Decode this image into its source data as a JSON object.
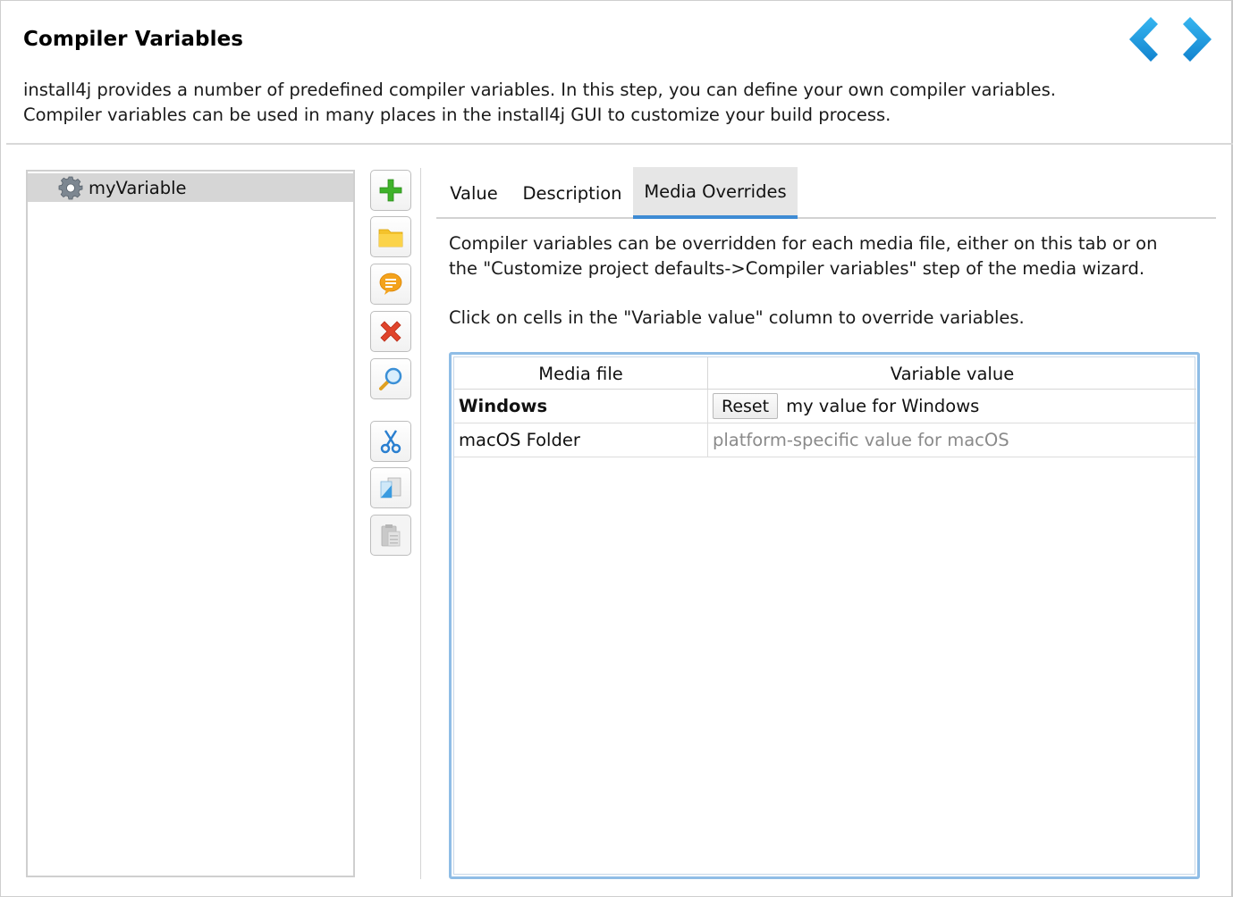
{
  "header": {
    "title": "Compiler Variables",
    "description": "install4j provides a number of predefined compiler variables. In this step, you can define your own compiler variables. Compiler variables can be used in many places in the install4j GUI to customize your build process.",
    "back_icon": "chevron-left-icon",
    "forward_icon": "chevron-right-icon",
    "accent_color": "#1e9be0"
  },
  "tree": {
    "items": [
      {
        "label": "myVariable",
        "icon": "gear-icon"
      }
    ]
  },
  "toolbar": {
    "buttons": [
      {
        "name": "add",
        "icon": "plus-icon"
      },
      {
        "name": "add-folder",
        "icon": "folder-icon"
      },
      {
        "name": "add-comment",
        "icon": "comment-icon"
      },
      {
        "name": "delete",
        "icon": "delete-x-icon"
      },
      {
        "name": "search",
        "icon": "magnifier-icon"
      },
      {
        "name": "cut",
        "icon": "scissors-icon"
      },
      {
        "name": "copy",
        "icon": "copy-icon"
      },
      {
        "name": "paste",
        "icon": "paste-icon",
        "disabled": true
      }
    ]
  },
  "tabs": [
    {
      "label": "Value"
    },
    {
      "label": "Description"
    },
    {
      "label": "Media Overrides",
      "active": true
    }
  ],
  "content": {
    "info1": "Compiler variables can be overridden for each media file, either on this tab or on the \"Customize project defaults->Compiler variables\" step of the media wizard.",
    "info2": "Click on cells in the \"Variable value\" column to override variables."
  },
  "table": {
    "columns": [
      "Media file",
      "Variable value"
    ],
    "rows": [
      {
        "media_file": "Windows",
        "reset_label": "Reset",
        "value": "my value for Windows",
        "overridden": true
      },
      {
        "media_file": "macOS Folder",
        "value": "platform-specific value for macOS",
        "overridden": false
      }
    ]
  }
}
